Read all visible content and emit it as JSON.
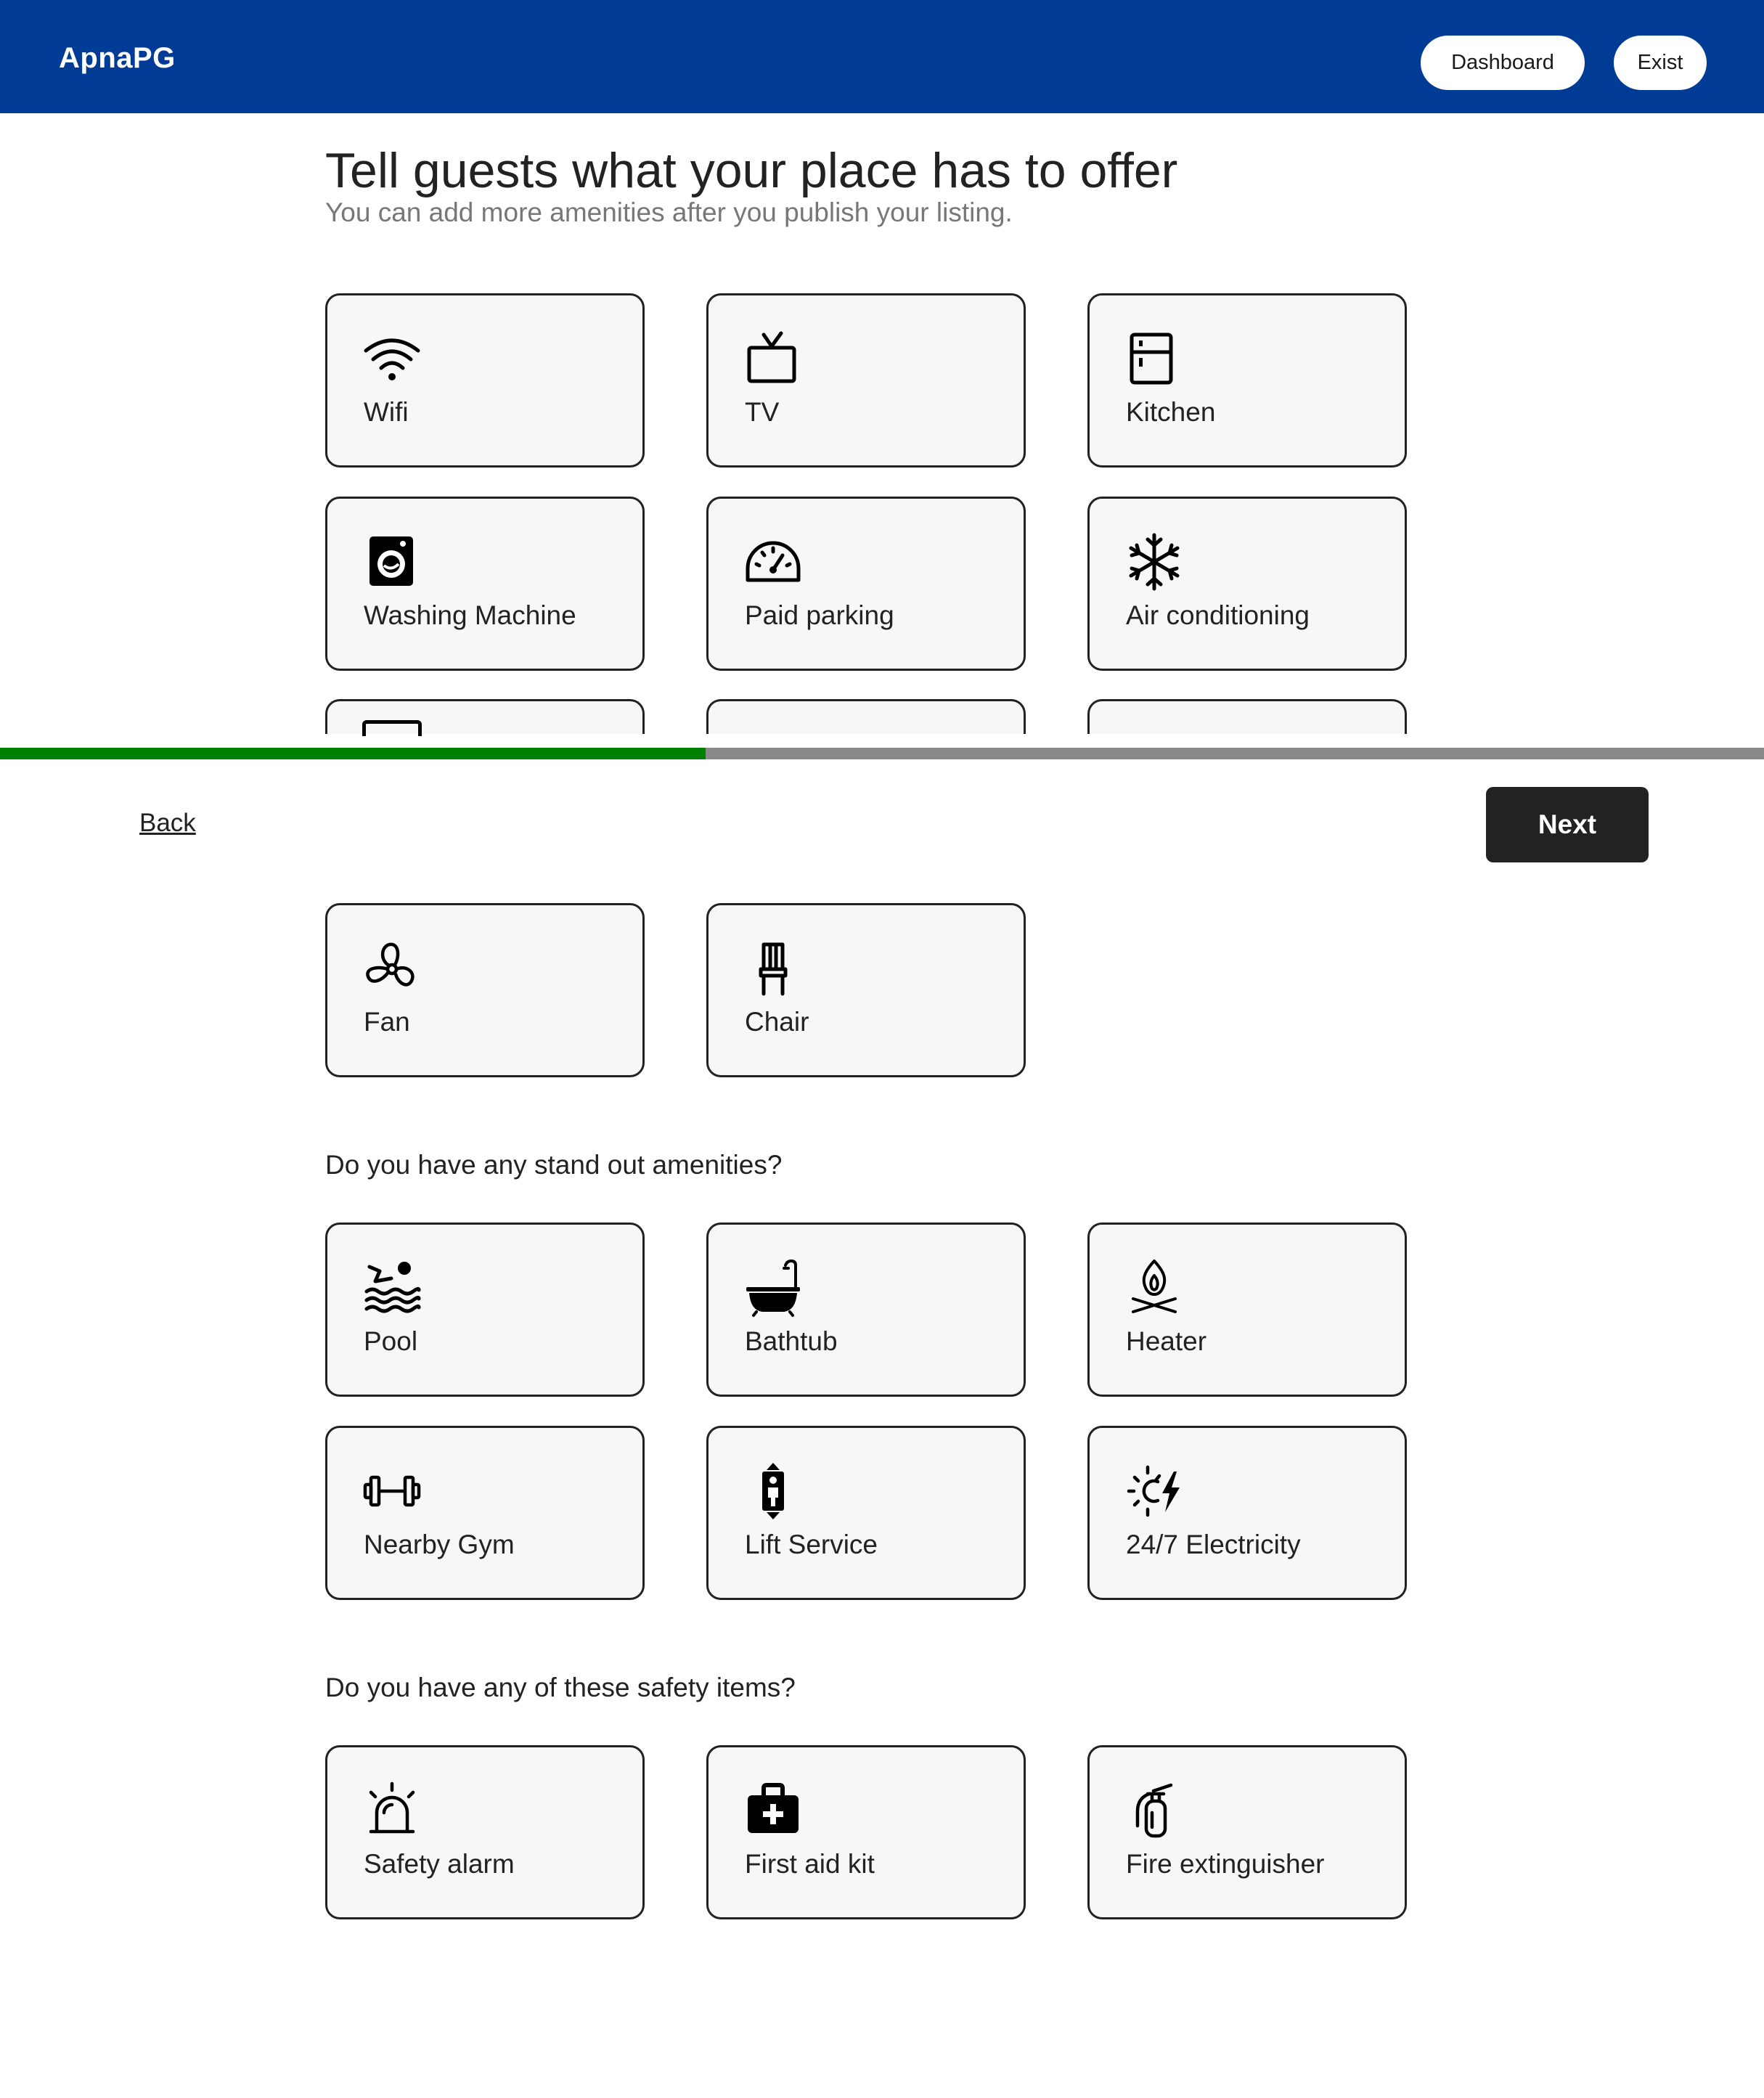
{
  "header": {
    "brand": "ApnaPG",
    "dashboard_label": "Dashboard",
    "exist_label": "Exist",
    "background_color": "#003b95"
  },
  "page": {
    "title": "Tell guests what your place has to offer",
    "subtitle": "You can add more amenities after you publish your listing."
  },
  "amenities": [
    {
      "label": "Wifi",
      "icon": "wifi-icon"
    },
    {
      "label": "TV",
      "icon": "tv-icon"
    },
    {
      "label": "Kitchen",
      "icon": "kitchen-icon"
    },
    {
      "label": "Washing Machine",
      "icon": "washing-machine-icon"
    },
    {
      "label": "Paid parking",
      "icon": "speedometer-icon"
    },
    {
      "label": "Air conditioning",
      "icon": "snowflake-icon"
    },
    {
      "label": "Fan",
      "icon": "fan-icon"
    },
    {
      "label": "Chair",
      "icon": "chair-icon"
    }
  ],
  "standout": {
    "heading": "Do you have any stand out amenities?",
    "items": [
      {
        "label": "Pool",
        "icon": "pool-icon"
      },
      {
        "label": "Bathtub",
        "icon": "bathtub-icon"
      },
      {
        "label": "Heater",
        "icon": "heater-icon"
      },
      {
        "label": "Nearby Gym",
        "icon": "dumbbell-icon"
      },
      {
        "label": "Lift Service",
        "icon": "lift-icon"
      },
      {
        "label": "24/7 Electricity",
        "icon": "electricity-icon"
      }
    ]
  },
  "safety": {
    "heading": "Do you have any of these safety items?",
    "items": [
      {
        "label": "Safety alarm",
        "icon": "alarm-icon"
      },
      {
        "label": "First aid kit",
        "icon": "first-aid-kit-icon"
      },
      {
        "label": "Fire extinguisher",
        "icon": "fire-extinguisher-icon"
      }
    ]
  },
  "progress": {
    "fraction": 0.4,
    "fill_color": "#008000",
    "track_color": "#888888"
  },
  "footer": {
    "back_label": "Back",
    "next_label": "Next"
  }
}
